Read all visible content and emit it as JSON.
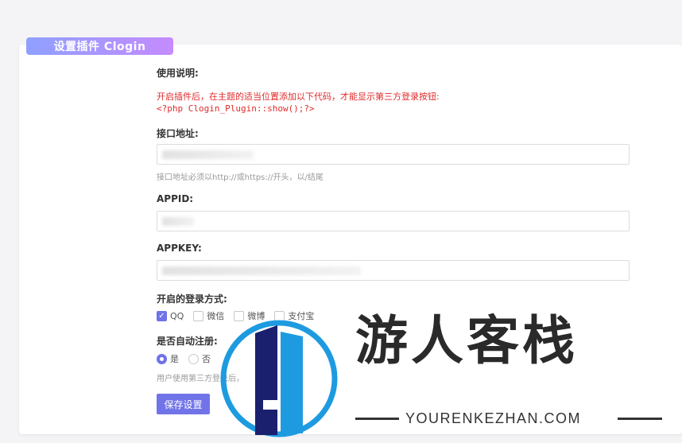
{
  "panel": {
    "title": "设置插件 Clogin"
  },
  "usage": {
    "label": "使用说明:",
    "note": "开启插件后，在主题的适当位置添加以下代码，才能显示第三方登录按钮:",
    "code": "<?php Clogin_Plugin::show();?>"
  },
  "api_url": {
    "label": "接口地址:",
    "hint": "接口地址必须以http://或https://开头，以/结尾"
  },
  "appid": {
    "label": "APPID:"
  },
  "appkey": {
    "label": "APPKEY:"
  },
  "login_methods": {
    "label": "开启的登录方式:",
    "options": [
      {
        "label": "QQ",
        "checked": true
      },
      {
        "label": "微信",
        "checked": false
      },
      {
        "label": "微博",
        "checked": false
      },
      {
        "label": "支付宝",
        "checked": false
      }
    ]
  },
  "auto_register": {
    "label": "是否自动注册:",
    "options": [
      {
        "label": "是",
        "checked": true
      },
      {
        "label": "否",
        "checked": false
      }
    ],
    "hint": "用户使用第三方登录后，"
  },
  "save_label": "保存设置",
  "watermark": {
    "cn": "游人客栈",
    "en": "YOURENKEZHAN.COM"
  },
  "colors": {
    "accent": "#7174e8",
    "warning": "#e02b2b",
    "tab_start": "#8fa0ff",
    "tab_end": "#c58bff"
  }
}
